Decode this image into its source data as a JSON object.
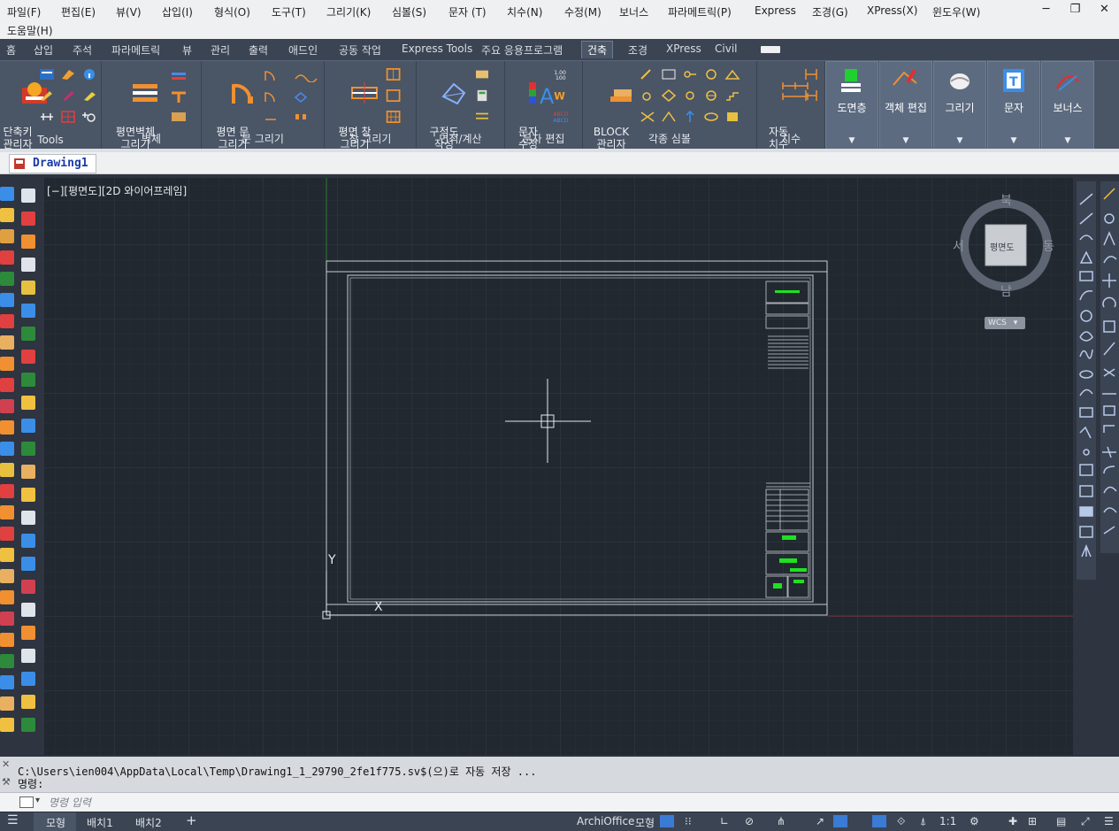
{
  "menubar": {
    "items": [
      "파일(F)",
      "편집(E)",
      "뷰(V)",
      "삽입(I)",
      "형식(O)",
      "도구(T)",
      "그리기(K)",
      "심볼(S)",
      "문자 (T)",
      "치수(N)",
      "수정(M)",
      "보너스",
      "파라메트릭(P)",
      "Express",
      "조경(G)",
      "XPress(X)",
      "윈도우(W)",
      "도움말(H)"
    ],
    "minimize": "─",
    "restore": "❐",
    "close": "✕"
  },
  "tabs": [
    "홈",
    "삽입",
    "주석",
    "파라메트릭",
    "뷰",
    "관리",
    "출력",
    "애드인",
    "공동 작업",
    "Express Tools",
    "주요 응용프로그램",
    "건축",
    "조경",
    "XPress",
    "Civil"
  ],
  "active_tab": "건축",
  "ribbon": {
    "tools_btn": "단축키\n관리자",
    "tools_title": "Tools",
    "wall_btn": "평면벽체\n그리기",
    "wall_title": "벽체",
    "door_btn": "평면 문\n그리기",
    "door_title": "문 그리기",
    "window_btn": "평면 창\n그리기",
    "window_title": "창 그리기",
    "area_btn": "구적도\n작성",
    "area_title": "면적/계산",
    "textedit_btn": "문자\n수정",
    "textedit_title": "문자 편집",
    "block_btn": "BLOCK\n관리자",
    "symbol_title": "각종 심볼",
    "dim_btn": "자동\n치수",
    "dim_title": "치수",
    "drawing_layer": "도면층",
    "object_edit": "객체 편집",
    "draw": "그리기",
    "text": "문자",
    "bonus": "보너스"
  },
  "filetab": {
    "name": "Drawing1"
  },
  "canvas": {
    "view_label": "[−][평면도][2D 와이어프레임]",
    "compass": {
      "north": "북",
      "south": "남",
      "east": "동",
      "west": "서",
      "center": "평면도",
      "wcs": "WCS"
    },
    "ucs_x": "X",
    "ucs_y": "Y"
  },
  "command": {
    "line1": "C:\\Users\\ien004\\AppData\\Local\\Temp\\Drawing1_1_29790_2fe1f775.sv$(으)로 자동 저장 ...",
    "line2": "명령:",
    "placeholder": "명령 입력"
  },
  "statusbar": {
    "layout_tabs": [
      "모형",
      "배치1",
      "배치2"
    ],
    "add": "+",
    "archioffice": "ArchiOffice",
    "model": "모형",
    "scale": "1:1"
  },
  "colors": {
    "accent_green": "#20e020",
    "ribbon_bg": "#4a5566",
    "canvas_bg": "#212830"
  }
}
